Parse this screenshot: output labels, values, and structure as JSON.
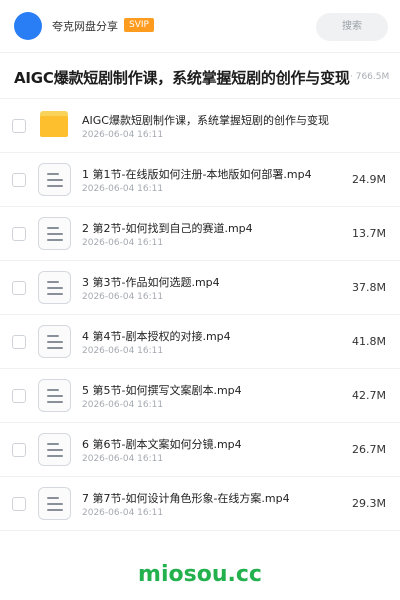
{
  "header": {
    "app_name": "夸克网盘分享",
    "badge": "SVIP",
    "search_label": "搜索"
  },
  "title_bar": {
    "title": "AIGC爆款短剧制作课，系统掌握短剧的创作与变现",
    "size": "766.5M"
  },
  "files": [
    {
      "type": "folder",
      "name": "AIGC爆款短剧制作课，系统掌握短剧的创作与变现",
      "date": "2026-06-04 16:11",
      "size": ""
    },
    {
      "type": "video",
      "name": "1 第1节-在线版如何注册-本地版如何部署.mp4",
      "date": "2026-06-04 16:11",
      "size": "24.9M"
    },
    {
      "type": "video",
      "name": "2 第2节-如何找到自己的赛道.mp4",
      "date": "2026-06-04 16:11",
      "size": "13.7M"
    },
    {
      "type": "video",
      "name": "3 第3节-作品如何选题.mp4",
      "date": "2026-06-04 16:11",
      "size": "37.8M"
    },
    {
      "type": "video",
      "name": "4 第4节-剧本授权的对接.mp4",
      "date": "2026-06-04 16:11",
      "size": "41.8M"
    },
    {
      "type": "video",
      "name": "5 第5节-如何撰写文案剧本.mp4",
      "date": "2026-06-04 16:11",
      "size": "42.7M"
    },
    {
      "type": "video",
      "name": "6 第6节-剧本文案如何分镜.mp4",
      "date": "2026-06-04 16:11",
      "size": "26.7M"
    },
    {
      "type": "video",
      "name": "7 第7节-如何设计角色形象-在线方案.mp4",
      "date": "2026-06-04 16:11",
      "size": "29.3M"
    }
  ],
  "watermark": "miosou.cc",
  "colors": {
    "accent": "#2a7ef5",
    "badge": "#ff9b1f",
    "folder": "#fdbf2d",
    "watermark": "#22b14c"
  }
}
